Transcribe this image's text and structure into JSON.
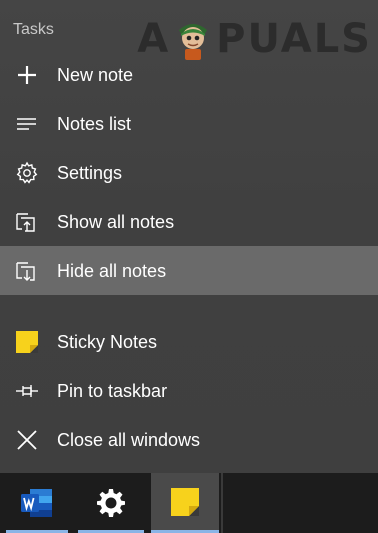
{
  "jumplist": {
    "section_title": "Tasks",
    "watermark": "APPUALS",
    "tasks": [
      {
        "label": "New note",
        "icon": "plus-icon"
      },
      {
        "label": "Notes list",
        "icon": "list-icon"
      },
      {
        "label": "Settings",
        "icon": "gear-icon"
      },
      {
        "label": "Show all notes",
        "icon": "show-notes-icon"
      },
      {
        "label": "Hide all notes",
        "icon": "hide-notes-icon",
        "hovered": true
      }
    ],
    "app_items": [
      {
        "label": "Sticky Notes",
        "icon": "sticky-notes-app-icon"
      },
      {
        "label": "Pin to taskbar",
        "icon": "pin-icon"
      },
      {
        "label": "Close all windows",
        "icon": "close-icon"
      }
    ]
  },
  "taskbar": {
    "apps": [
      {
        "name": "Word",
        "icon": "word-icon",
        "running": true
      },
      {
        "name": "Settings",
        "icon": "gear-icon",
        "running": true
      },
      {
        "name": "Sticky Notes",
        "icon": "sticky-notes-icon",
        "running": true,
        "active": true
      }
    ]
  },
  "colors": {
    "hover": "#6a6a6a",
    "accent_underline": "#8ab4e6",
    "sticky_yellow": "#f7d21c"
  }
}
